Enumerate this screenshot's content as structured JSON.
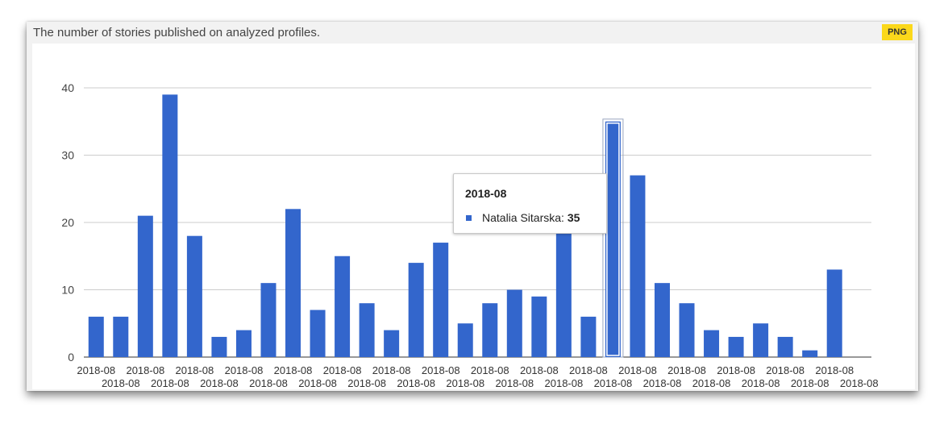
{
  "header": {
    "title": "The number of stories published on analyzed profiles.",
    "export_label": "PNG"
  },
  "colors": {
    "bar": "#3366cc",
    "grid": "#cccccc",
    "axis": "#333333",
    "export_button": "#fbd81b"
  },
  "chart_data": {
    "type": "bar",
    "title": "The number of stories published on analyzed profiles.",
    "xlabel": "",
    "ylabel": "",
    "ylim": [
      0,
      40
    ],
    "yticks": [
      0,
      10,
      20,
      30,
      40
    ],
    "grid": true,
    "categories": [
      "2018-08",
      "2018-08",
      "2018-08",
      "2018-08",
      "2018-08",
      "2018-08",
      "2018-08",
      "2018-08",
      "2018-08",
      "2018-08",
      "2018-08",
      "2018-08",
      "2018-08",
      "2018-08",
      "2018-08",
      "2018-08",
      "2018-08",
      "2018-08",
      "2018-08",
      "2018-08",
      "2018-08",
      "2018-08",
      "2018-08",
      "2018-08",
      "2018-08",
      "2018-08",
      "2018-08",
      "2018-08",
      "2018-08",
      "2018-08",
      "2018-08",
      "2018-08"
    ],
    "series": [
      {
        "values": [
          6,
          6,
          21,
          39,
          18,
          3,
          4,
          11,
          22,
          7,
          15,
          8,
          4,
          14,
          17,
          5,
          8,
          10,
          9,
          19,
          6,
          35,
          27,
          11,
          8,
          4,
          3,
          5,
          3,
          1,
          13,
          0
        ]
      }
    ],
    "highlighted_index": 21
  },
  "tooltip": {
    "title": "2018-08",
    "series_name": "Natalia Sitarska",
    "value": "35"
  }
}
